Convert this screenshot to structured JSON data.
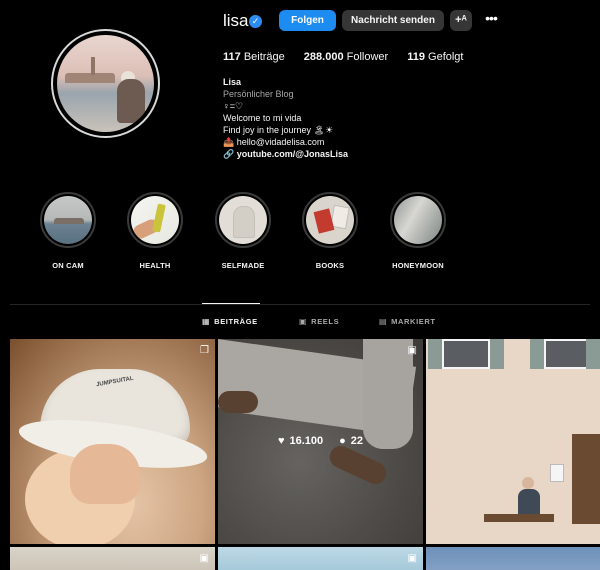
{
  "profile": {
    "username": "lisa",
    "buttons": {
      "follow": "Folgen",
      "message": "Nachricht senden",
      "suggest": "+ᴬ"
    },
    "stats": [
      {
        "count": "117",
        "label": "Beiträge"
      },
      {
        "count": "288.000",
        "label": "Follower"
      },
      {
        "count": "119",
        "label": "Gefolgt"
      }
    ],
    "bio": {
      "name": "Lisa",
      "category": "Persönlicher Blog",
      "line1": "♀=♡",
      "line2": "Welcome to mi vida",
      "line3": "Find joy in the journey 🏝☀",
      "email": "📤 hello@vidadelisa.com",
      "link": "youtube.com/@JonasLisa",
      "link_icon": "🔗"
    }
  },
  "highlights": [
    {
      "label": "ON CAM"
    },
    {
      "label": "HEALTH"
    },
    {
      "label": "SELFMADE"
    },
    {
      "label": "BOOKS"
    },
    {
      "label": "HONEYMOON"
    }
  ],
  "tabs": [
    {
      "label": "BEITRÄGE",
      "icon": "▦"
    },
    {
      "label": "REELS",
      "icon": "▣"
    },
    {
      "label": "MARKIERT",
      "icon": "▤"
    }
  ],
  "post_overlay": {
    "likes": "16.100",
    "comments": "22",
    "like_icon": "♥",
    "comment_icon": "●"
  },
  "post1_hat_text": "JUMPSUITAL"
}
